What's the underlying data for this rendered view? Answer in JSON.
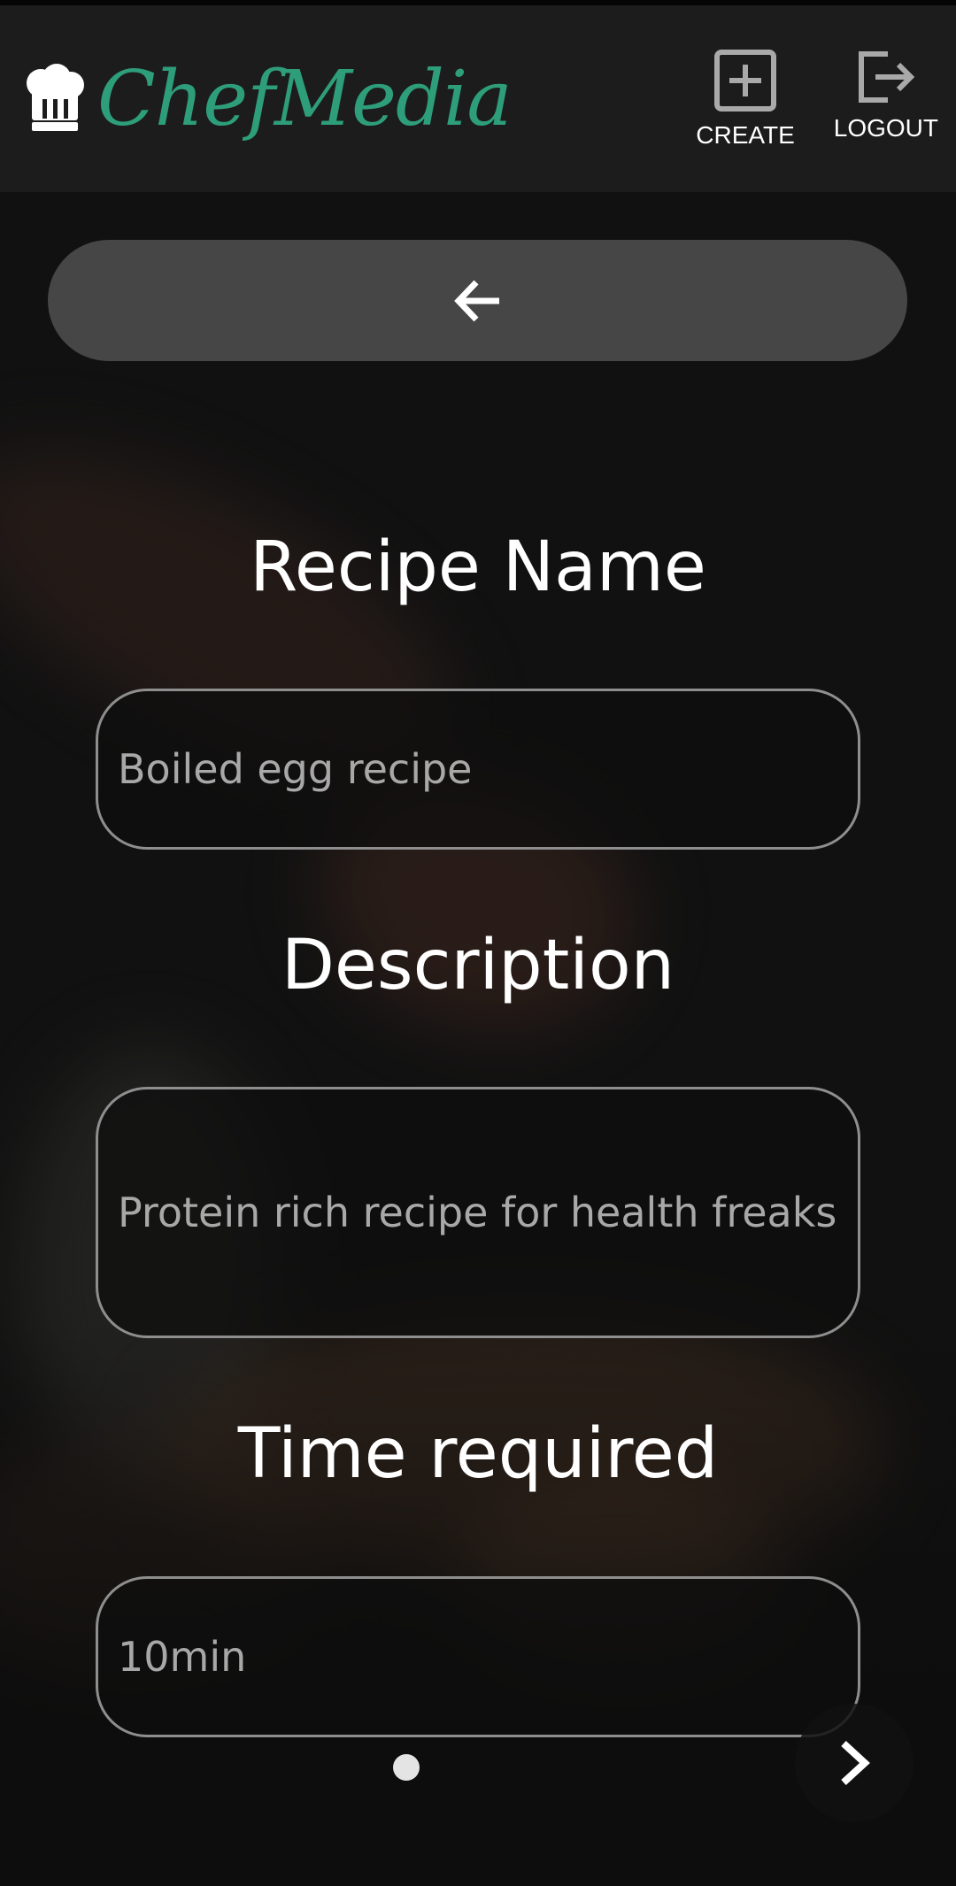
{
  "header": {
    "brand_name": "ChefMedia",
    "brand_color": "#2e9e7a",
    "brand_icon": "chef-hat-icon",
    "create_label": "CREATE",
    "logout_label": "LOGOUT"
  },
  "navigation": {
    "back_icon": "arrow-left-icon",
    "next_icon": "chevron-right-icon",
    "page_indicator_count": 1
  },
  "form": {
    "recipe_name": {
      "label": "Recipe Name",
      "value": "Boiled egg recipe"
    },
    "description": {
      "label": "Description",
      "value": "Protein rich recipe for health freaks"
    },
    "time_required": {
      "label": "Time required",
      "value": "10min"
    }
  }
}
